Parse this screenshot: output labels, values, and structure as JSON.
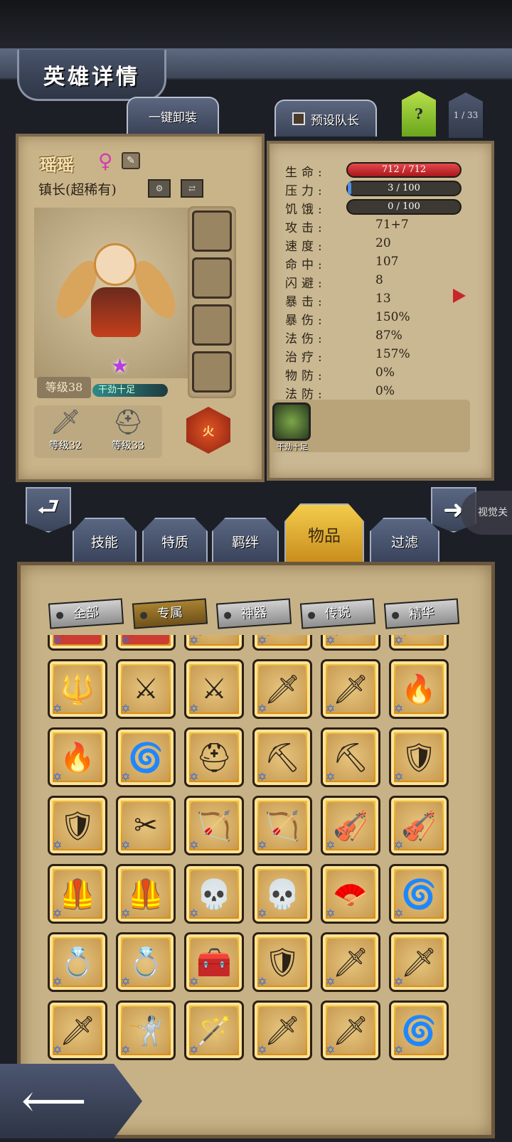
{
  "header": {
    "title": "英雄详情"
  },
  "top_buttons": {
    "unequip_all": "一键卸装",
    "preset_captain": "预设队长",
    "help": "?",
    "page": "1 / 33"
  },
  "hero": {
    "name": "瑶瑶",
    "gender_icon": "female-icon",
    "class": "镇长(超稀有)",
    "level": "等级38",
    "status": "干劲十足",
    "element": "火",
    "equipment": [
      {
        "icon": "sword-icon",
        "level": "等级32"
      },
      {
        "icon": "helmet-icon",
        "level": "等级33"
      }
    ]
  },
  "stats": {
    "hp": {
      "label": "生命:",
      "value": "712 / 712"
    },
    "stress": {
      "label": "压力:",
      "value": "3 / 100",
      "fraction": 0.03
    },
    "hunger": {
      "label": "饥饿:",
      "value": "0 / 100",
      "fraction": 0.0
    },
    "rows": [
      {
        "label": "攻击:",
        "value": "71+7"
      },
      {
        "label": "速度:",
        "value": "20"
      },
      {
        "label": "命中:",
        "value": "107"
      },
      {
        "label": "闪避:",
        "value": "8"
      },
      {
        "label": "暴击:",
        "value": "13"
      },
      {
        "label": "暴伤:",
        "value": "150%"
      },
      {
        "label": "法伤:",
        "value": "87%"
      },
      {
        "label": "治疗:",
        "value": "157%"
      },
      {
        "label": "物防:",
        "value": "0%"
      },
      {
        "label": "法防:",
        "value": "0%"
      }
    ],
    "skill_label": "干劲十足"
  },
  "nav": {
    "close_label": "视觉关"
  },
  "category_tabs": [
    "技能",
    "特质",
    "羁绊",
    "物品",
    "过滤"
  ],
  "active_category": "物品",
  "filters": [
    "全部",
    "专属",
    "神器",
    "传说",
    "精华"
  ],
  "active_filter": "专属",
  "inventory": {
    "rows": [
      [
        "🗡",
        "🗡",
        "🗡",
        "🗡",
        "🗡",
        "🗡"
      ],
      [
        "🔱",
        "⚔",
        "⚔",
        "🗡",
        "🗡",
        "🔥"
      ],
      [
        "🔥",
        "🌀",
        "⛑",
        "⛏",
        "⛏",
        "🛡"
      ],
      [
        "🛡",
        "✂",
        "🏹",
        "🏹",
        "🎻",
        "🎻"
      ],
      [
        "🦺",
        "🦺",
        "💀",
        "💀",
        "🪭",
        "🌀"
      ],
      [
        "💍",
        "💍",
        "🧰",
        "🛡",
        "🗡",
        "🗡"
      ],
      [
        "🗡",
        "🤺",
        "🪄",
        "🗡",
        "🗡",
        "🌀"
      ]
    ]
  }
}
